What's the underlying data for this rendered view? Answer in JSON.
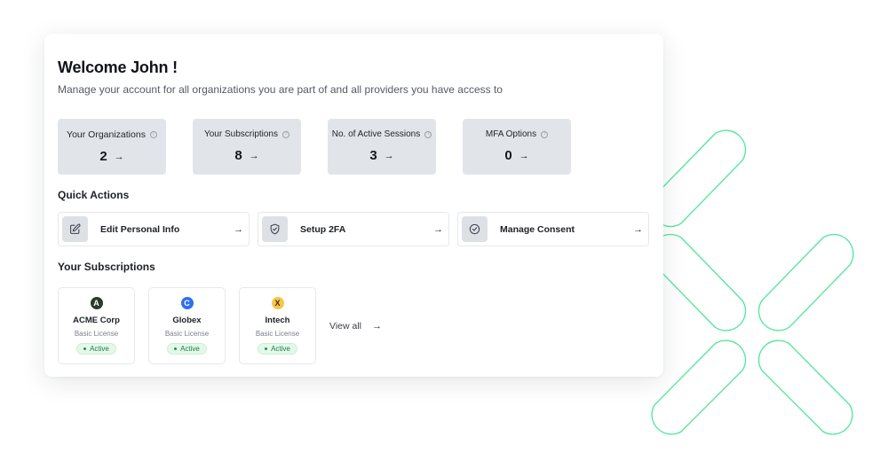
{
  "header": {
    "title": "Welcome John !",
    "subtitle": "Manage your account for all organizations you are part of and all providers you have access to"
  },
  "stats": [
    {
      "label": "Your Organizations",
      "value": "2",
      "icon": "info-icon",
      "arrow": "→"
    },
    {
      "label": "Your Subscriptions",
      "value": "8",
      "icon": "info-icon",
      "arrow": "→"
    },
    {
      "label": "No. of Active Sessions",
      "value": "3",
      "icon": "info-icon",
      "arrow": "→"
    },
    {
      "label": "MFA Options",
      "value": "0",
      "icon": "info-icon",
      "arrow": "→"
    }
  ],
  "quick_actions": {
    "title": "Quick Actions",
    "items": [
      {
        "label": "Edit Personal Info",
        "icon": "edit-icon",
        "arrow": "→"
      },
      {
        "label": "Setup 2FA",
        "icon": "shield-check-icon",
        "arrow": "→"
      },
      {
        "label": "Manage Consent",
        "icon": "check-circle-icon",
        "arrow": "→"
      }
    ]
  },
  "subscriptions": {
    "title": "Your Subscriptions",
    "items": [
      {
        "logo_letter": "A",
        "logo_color": "#2c3a2a",
        "logo_text_color": "#ffffff",
        "name": "ACME Corp",
        "license": "Basic License",
        "status": "Active"
      },
      {
        "logo_letter": "C",
        "logo_color": "#2f6ff0",
        "logo_text_color": "#ffffff",
        "name": "Globex",
        "license": "Basic License",
        "status": "Active"
      },
      {
        "logo_letter": "X",
        "logo_color": "#f7c548",
        "logo_text_color": "#3a2e10",
        "name": "Intech",
        "license": "Basic License",
        "status": "Active"
      }
    ],
    "view_all_label": "View all",
    "view_all_arrow": "→"
  },
  "colors": {
    "accent_green": "#4ee69a",
    "stat_bg": "#e1e5ea",
    "active_badge_bg": "#e4f8ea",
    "active_badge_text": "#1a7f45"
  }
}
